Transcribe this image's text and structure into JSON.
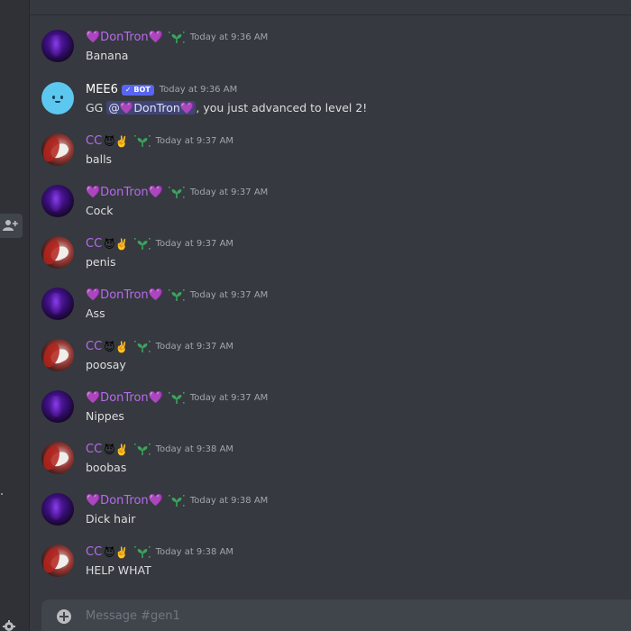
{
  "messages": [
    {
      "author": "💜DonTron💜",
      "author_style": "purple",
      "avatar": "don",
      "emoji": "",
      "timestamp": "Today at 9:36 AM",
      "content": "Banana"
    },
    {
      "author": "MEE6",
      "author_style": "white",
      "avatar": "mee6",
      "badge": "✓ BOT",
      "timestamp": "Today at 9:36 AM",
      "content_prefix": "GG ",
      "mention": "@💜DonTron💜",
      "content_suffix": ", you just advanced to level 2!"
    },
    {
      "author": "CC",
      "author_style": "purple",
      "avatar": "cc",
      "emoji": "😈✌️",
      "timestamp": "Today at 9:37 AM",
      "content": "balls"
    },
    {
      "author": "💜DonTron💜",
      "author_style": "purple",
      "avatar": "don",
      "emoji": "",
      "timestamp": "Today at 9:37 AM",
      "content": "Cock"
    },
    {
      "author": "CC",
      "author_style": "purple",
      "avatar": "cc",
      "emoji": "😈✌️",
      "timestamp": "Today at 9:37 AM",
      "content": "penis"
    },
    {
      "author": "💜DonTron💜",
      "author_style": "purple",
      "avatar": "don",
      "emoji": "",
      "timestamp": "Today at 9:37 AM",
      "content": "Ass"
    },
    {
      "author": "CC",
      "author_style": "purple",
      "avatar": "cc",
      "emoji": "😈✌️",
      "timestamp": "Today at 9:37 AM",
      "content": "poosay"
    },
    {
      "author": "💜DonTron💜",
      "author_style": "purple",
      "avatar": "don",
      "emoji": "",
      "timestamp": "Today at 9:37 AM",
      "content": "Nippes"
    },
    {
      "author": "CC",
      "author_style": "purple",
      "avatar": "cc",
      "emoji": "😈✌️",
      "timestamp": "Today at 9:38 AM",
      "content": "boobas"
    },
    {
      "author": "💜DonTron💜",
      "author_style": "purple",
      "avatar": "don",
      "emoji": "",
      "timestamp": "Today at 9:38 AM",
      "content": "Dick hair"
    },
    {
      "author": "CC",
      "author_style": "purple",
      "avatar": "cc",
      "emoji": "😈✌️",
      "timestamp": "Today at 9:38 AM",
      "content": "HELP WHAT"
    }
  ],
  "composer": {
    "placeholder": "Message #gen1"
  },
  "icons": {
    "add_member": "add-member-icon",
    "settings": "gear-icon",
    "sprout": "sprout-role-icon",
    "attach": "plus-circle-icon"
  },
  "colors": {
    "background": "#36393f",
    "sidebar": "#2f3136",
    "username_purple": "#b86af0",
    "timestamp": "#a3a6aa",
    "message_text": "#dcddde",
    "bot_badge": "#5865f2",
    "mention_bg": "#414675",
    "sprout_green": "#3ba55c"
  }
}
